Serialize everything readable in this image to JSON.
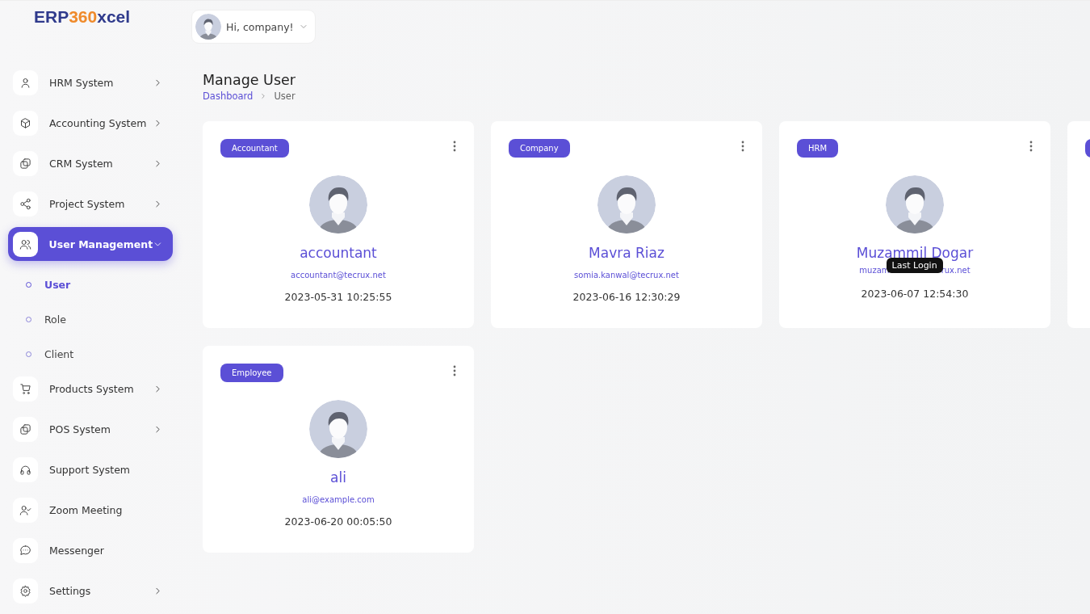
{
  "logo": {
    "part_1": "ERP",
    "part_2": "360",
    "part_3": "xcel"
  },
  "user_menu": {
    "greeting": "Hi, company!"
  },
  "sidebar": {
    "items": [
      {
        "label": "HRM System",
        "has_arrow": true,
        "selected": false
      },
      {
        "label": "Accounting System",
        "has_arrow": true,
        "selected": false
      },
      {
        "label": "CRM System",
        "has_arrow": true,
        "selected": false
      },
      {
        "label": "Project System",
        "has_arrow": true,
        "selected": false
      },
      {
        "label": "User Management",
        "has_arrow": true,
        "selected": true,
        "expanded": true,
        "children": [
          {
            "label": "User",
            "selected": true
          },
          {
            "label": "Role",
            "selected": false
          },
          {
            "label": "Client",
            "selected": false
          }
        ]
      },
      {
        "label": "Products System",
        "has_arrow": true,
        "selected": false
      },
      {
        "label": "POS System",
        "has_arrow": true,
        "selected": false
      },
      {
        "label": "Support System",
        "has_arrow": false,
        "selected": false
      },
      {
        "label": "Zoom Meeting",
        "has_arrow": false,
        "selected": false
      },
      {
        "label": "Messenger",
        "has_arrow": false,
        "selected": false
      },
      {
        "label": "Settings",
        "has_arrow": true,
        "selected": false
      }
    ]
  },
  "page": {
    "title": "Manage User",
    "breadcrumb": [
      {
        "label": "Dashboard",
        "kind": "link"
      },
      {
        "label": "User",
        "kind": "current"
      }
    ]
  },
  "users": [
    {
      "kind": "full",
      "role": "Accountant",
      "name": "accountant",
      "email": "accountant@tecrux.net",
      "last_login": "2023-05-31 10:25:55"
    },
    {
      "kind": "full",
      "role": "Company",
      "name": "Mavra Riaz",
      "email": "somia.kanwal@tecrux.net",
      "last_login": "2023-06-16 12:30:29"
    },
    {
      "kind": "tooltip",
      "role": "HRM",
      "name": "Muzammil Dogar",
      "email_start": "muzam",
      "email_end": "rux.net",
      "tooltip": "Last Login",
      "last_login": "2023-06-07 12:54:30"
    },
    {
      "kind": "cut"
    },
    {
      "kind": "full",
      "role": "Employee",
      "name": "ali",
      "email": "ali@example.com",
      "last_login": "2023-06-20 00:05:50"
    }
  ]
}
